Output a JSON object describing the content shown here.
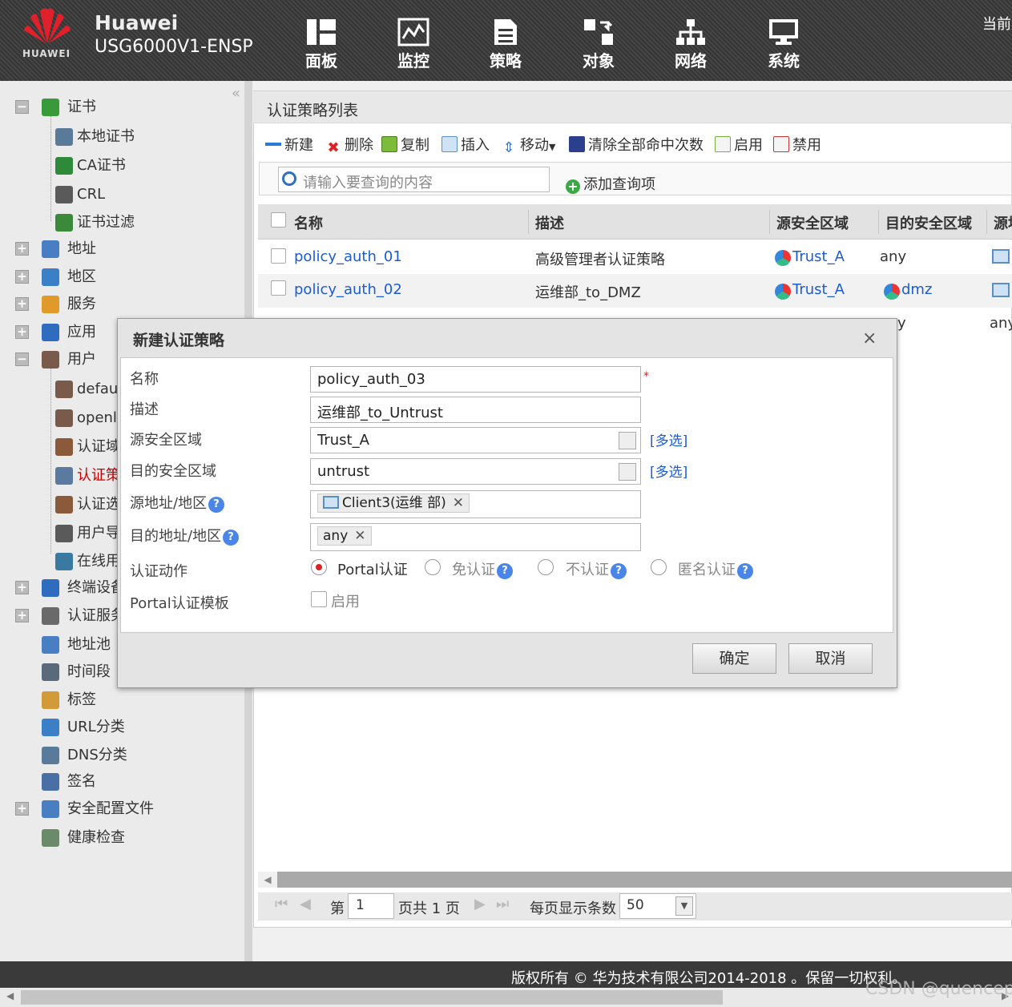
{
  "header": {
    "logo_text": "HUAWEI",
    "brand": "Huawei",
    "model": "USG6000V1-ENSP",
    "current_user": "当前",
    "nav": [
      {
        "label": "面板",
        "icon": "dashboard-icon"
      },
      {
        "label": "监控",
        "icon": "monitor-icon"
      },
      {
        "label": "策略",
        "icon": "policy-icon"
      },
      {
        "label": "对象",
        "icon": "object-icon"
      },
      {
        "label": "网络",
        "icon": "network-icon"
      },
      {
        "label": "系统",
        "icon": "system-icon"
      }
    ]
  },
  "sidebar": {
    "collapse_glyph": "«",
    "items": [
      {
        "label": "证书",
        "expander": "−"
      },
      {
        "label": "本地证书"
      },
      {
        "label": "CA证书"
      },
      {
        "label": "CRL"
      },
      {
        "label": "证书过滤"
      },
      {
        "label": "地址",
        "expander": "+"
      },
      {
        "label": "地区",
        "expander": "+"
      },
      {
        "label": "服务",
        "expander": "+"
      },
      {
        "label": "应用",
        "expander": "+"
      },
      {
        "label": "用户",
        "expander": "−"
      },
      {
        "label": "defaul"
      },
      {
        "label": "openla"
      },
      {
        "label": "认证域"
      },
      {
        "label": "认证策"
      },
      {
        "label": "认证选"
      },
      {
        "label": "用户导"
      },
      {
        "label": "在线用"
      },
      {
        "label": "终端设备",
        "expander": "+"
      },
      {
        "label": "认证服务",
        "expander": "+"
      },
      {
        "label": "地址池"
      },
      {
        "label": "时间段"
      },
      {
        "label": "标签"
      },
      {
        "label": "URL分类"
      },
      {
        "label": "DNS分类"
      },
      {
        "label": "签名"
      },
      {
        "label": "安全配置文件",
        "expander": "+"
      },
      {
        "label": "健康检查"
      }
    ]
  },
  "panel": {
    "title": "认证策略列表",
    "toolbar": {
      "new": "新建",
      "delete": "删除",
      "copy": "复制",
      "insert": "插入",
      "move": "移动",
      "clear_hits": "清除全部命中次数",
      "enable": "启用",
      "disable": "禁用"
    },
    "search_placeholder": "请输入要查询的内容",
    "add_query": "添加查询项",
    "columns": [
      "名称",
      "描述",
      "源安全区域",
      "目的安全区域",
      "源地"
    ],
    "rows": [
      {
        "name": "policy_auth_01",
        "desc": "高级管理者认证策略",
        "src_zone": "Trust_A",
        "dst_zone": "any"
      },
      {
        "name": "policy_auth_02",
        "desc": "运维部_to_DMZ",
        "src_zone": "Trust_A",
        "dst_zone": "dmz"
      }
    ],
    "row3_partial": [
      "y",
      "any"
    ],
    "pager": {
      "page_prefix": "第",
      "page": "1",
      "page_suffix": "页共 1 页",
      "per_page_label": "每页显示条数",
      "per_page": "50"
    }
  },
  "dialog": {
    "title": "新建认证策略",
    "close": "×",
    "fields": {
      "name_label": "名称",
      "name_value": "policy_auth_03",
      "required": "*",
      "desc_label": "描述",
      "desc_value": "运维部_to_Untrust",
      "src_zone_label": "源安全区域",
      "src_zone_value": "Trust_A",
      "multi": "[多选]",
      "dst_zone_label": "目的安全区域",
      "dst_zone_value": "untrust",
      "src_addr_label": "源地址/地区",
      "src_addr_tag": "Client3(运维 部)",
      "dst_addr_label": "目的地址/地区",
      "dst_addr_tag": "any",
      "action_label": "认证动作",
      "actions": [
        "Portal认证",
        "免认证",
        "不认证",
        "匿名认证"
      ],
      "action_selected": "Portal认证",
      "portal_label": "Portal认证模板",
      "portal_enable": "启用"
    },
    "ok": "确定",
    "cancel": "取消"
  },
  "footer": {
    "copyright": "版权所有 © 华为技术有限公司2014-2018 。保留一切权利。",
    "watermark": "CSDN @quencep"
  }
}
